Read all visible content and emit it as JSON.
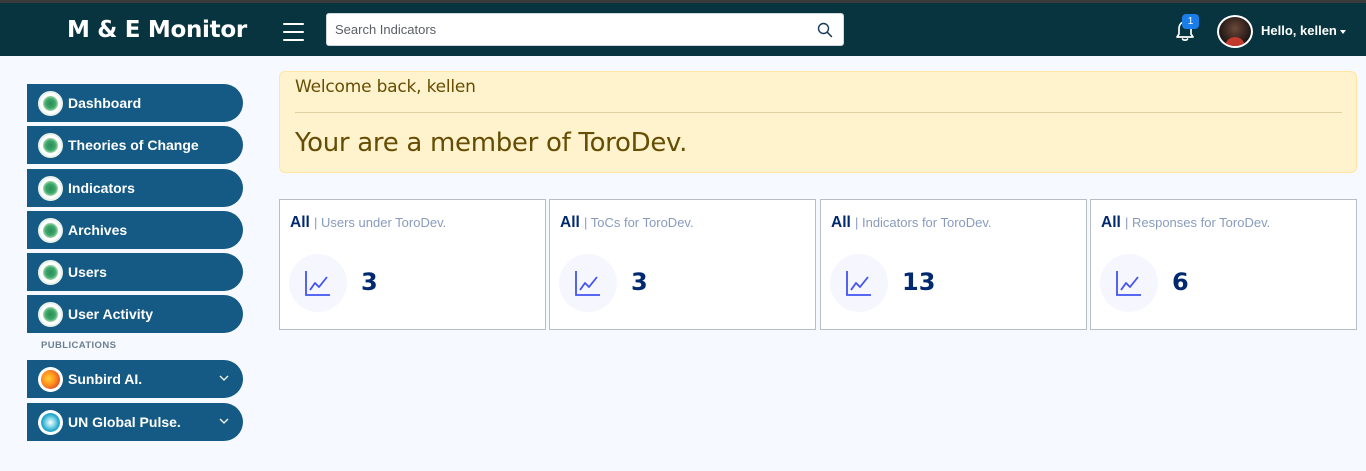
{
  "header": {
    "brand": "M & E Monitor",
    "search_placeholder": "Search Indicators",
    "notification_count": "1",
    "user_greeting": "Hello, kellen"
  },
  "sidebar": {
    "items": [
      {
        "label": "Dashboard"
      },
      {
        "label": "Theories of Change"
      },
      {
        "label": "Indicators"
      },
      {
        "label": "Archives"
      },
      {
        "label": "Users"
      },
      {
        "label": "User Activity"
      }
    ],
    "section_title": "PUBLICATIONS",
    "publications": [
      {
        "label": "Sunbird AI."
      },
      {
        "label": "UN Global Pulse."
      }
    ]
  },
  "alert": {
    "welcome": "Welcome back, kellen",
    "member": "Your are a member of ToroDev."
  },
  "cards": [
    {
      "filter": "All",
      "subtitle": "| Users under ToroDev.",
      "value": "3"
    },
    {
      "filter": "All",
      "subtitle": "| ToCs for ToroDev.",
      "value": "3"
    },
    {
      "filter": "All",
      "subtitle": "| Indicators for ToroDev.",
      "value": "13"
    },
    {
      "filter": "All",
      "subtitle": "| Responses for ToroDev.",
      "value": "6"
    }
  ],
  "colors": {
    "header_bg": "#07343f",
    "sidebar_item_bg": "#155a85",
    "alert_bg": "#fff3cd",
    "card_value": "#012970",
    "badge": "#1a7de8"
  },
  "icons": {
    "search": "search-icon",
    "bell": "bell-icon",
    "menu": "hamburger-menu-icon",
    "card": "line-chart-icon",
    "chevron": "chevron-down-icon"
  }
}
